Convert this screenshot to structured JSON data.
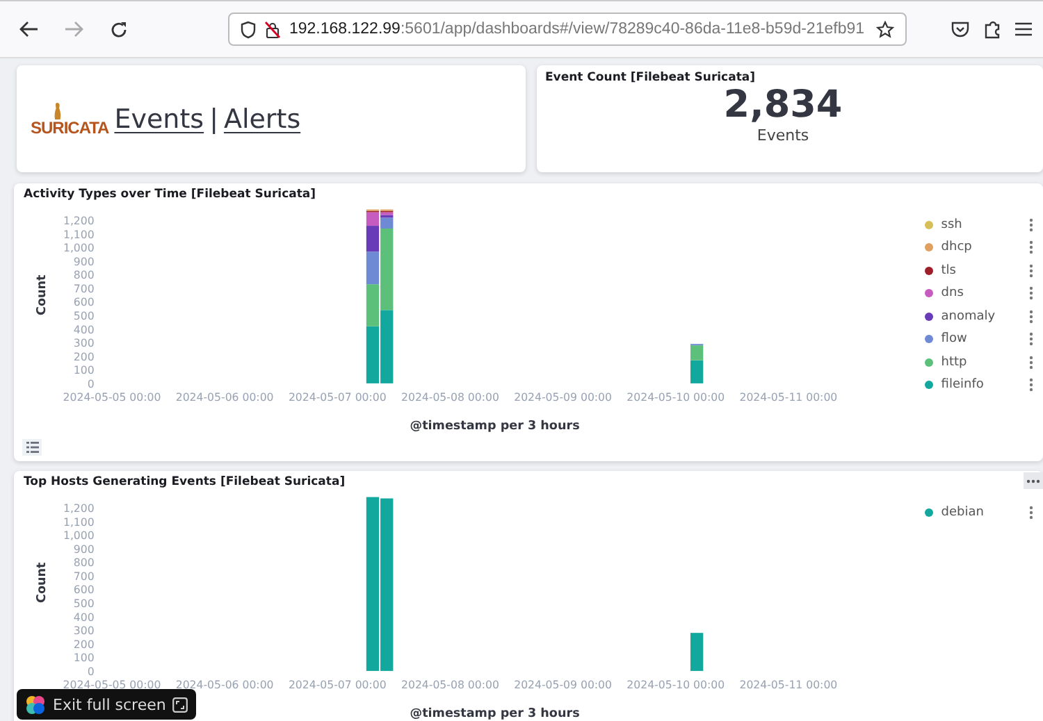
{
  "browser": {
    "url_host": "192.168.122.99",
    "url_rest": ":5601/app/dashboards#/view/78289c40-86da-11e8-b59d-21efb91",
    "forward_disabled": true
  },
  "logo_panel": {
    "logo": "SURICATA",
    "links": [
      "Events",
      "Alerts"
    ],
    "separator": "|"
  },
  "metric_panel": {
    "title": "Event Count [Filebeat Suricata]",
    "value": "2,834",
    "label": "Events"
  },
  "charts": [
    {
      "title": "Activity Types over Time [Filebeat Suricata]",
      "legend_toggle": true,
      "panel_menu": false,
      "chart_data": {
        "type": "bar",
        "stacked": true,
        "xlabel": "@timestamp per 3 hours",
        "ylabel": "Count",
        "ylim": [
          0,
          1300
        ],
        "yticks": [
          0,
          100,
          200,
          300,
          400,
          500,
          600,
          700,
          800,
          900,
          {
            "value": 1000,
            "label": "1,000"
          },
          {
            "value": 1100,
            "label": "1,100"
          },
          {
            "value": 1200,
            "label": "1,200"
          }
        ],
        "categories": [
          "2024-05-05 00:00",
          null,
          null,
          null,
          null,
          null,
          null,
          null,
          "2024-05-06 00:00",
          null,
          null,
          null,
          null,
          null,
          null,
          null,
          "2024-05-07 00:00",
          null,
          null,
          null,
          null,
          null,
          null,
          null,
          "2024-05-08 00:00",
          null,
          null,
          null,
          null,
          null,
          null,
          null,
          "2024-05-09 00:00",
          null,
          null,
          null,
          null,
          null,
          null,
          null,
          "2024-05-10 00:00",
          null,
          null,
          null,
          null,
          null,
          null,
          null,
          "2024-05-11 00:00",
          null,
          null,
          null,
          null,
          null,
          null
        ],
        "series": [
          {
            "name": "ssh",
            "color": "#d6bf57",
            "values": [
              null,
              null,
              null,
              null,
              null,
              null,
              null,
              null,
              null,
              null,
              null,
              null,
              null,
              null,
              null,
              null,
              null,
              null,
              0,
              0,
              null,
              null,
              null,
              null,
              null,
              null,
              null,
              null,
              null,
              null,
              null,
              null,
              null,
              null,
              null,
              null,
              null,
              null,
              null,
              null,
              null,
              0,
              null,
              null,
              null,
              null,
              null,
              null,
              null,
              null,
              null,
              null,
              null,
              null,
              null
            ]
          },
          {
            "name": "dhcp",
            "color": "#e0a060",
            "values": [
              null,
              null,
              null,
              null,
              null,
              null,
              null,
              null,
              null,
              null,
              null,
              null,
              null,
              null,
              null,
              null,
              null,
              null,
              10,
              10,
              null,
              null,
              null,
              null,
              null,
              null,
              null,
              null,
              null,
              null,
              null,
              null,
              null,
              null,
              null,
              null,
              null,
              null,
              null,
              null,
              null,
              0,
              null,
              null,
              null,
              null,
              null,
              null,
              null,
              null,
              null,
              null,
              null,
              null,
              null
            ]
          },
          {
            "name": "tls",
            "color": "#9e1f2a",
            "values": [
              null,
              null,
              null,
              null,
              null,
              null,
              null,
              null,
              null,
              null,
              null,
              null,
              null,
              null,
              null,
              null,
              null,
              null,
              10,
              10,
              null,
              null,
              null,
              null,
              null,
              null,
              null,
              null,
              null,
              null,
              null,
              null,
              null,
              null,
              null,
              null,
              null,
              null,
              null,
              null,
              null,
              0,
              null,
              null,
              null,
              null,
              null,
              null,
              null,
              null,
              null,
              null,
              null,
              null,
              null
            ]
          },
          {
            "name": "dns",
            "color": "#c65bc0",
            "values": [
              null,
              null,
              null,
              null,
              null,
              null,
              null,
              null,
              null,
              null,
              null,
              null,
              null,
              null,
              null,
              null,
              null,
              null,
              100,
              20,
              null,
              null,
              null,
              null,
              null,
              null,
              null,
              null,
              null,
              null,
              null,
              null,
              null,
              null,
              null,
              null,
              null,
              null,
              null,
              null,
              null,
              0,
              null,
              null,
              null,
              null,
              null,
              null,
              null,
              null,
              null,
              null,
              null,
              null,
              null
            ]
          },
          {
            "name": "anomaly",
            "color": "#6a3bb8",
            "values": [
              null,
              null,
              null,
              null,
              null,
              null,
              null,
              null,
              null,
              null,
              null,
              null,
              null,
              null,
              null,
              null,
              null,
              null,
              190,
              20,
              null,
              null,
              null,
              null,
              null,
              null,
              null,
              null,
              null,
              null,
              null,
              null,
              null,
              null,
              null,
              null,
              null,
              null,
              null,
              null,
              null,
              0,
              null,
              null,
              null,
              null,
              null,
              null,
              null,
              null,
              null,
              null,
              null,
              null,
              null
            ]
          },
          {
            "name": "flow",
            "color": "#6f8ad4",
            "values": [
              null,
              null,
              null,
              null,
              null,
              null,
              null,
              null,
              null,
              null,
              null,
              null,
              null,
              null,
              null,
              null,
              null,
              null,
              240,
              80,
              null,
              null,
              null,
              null,
              null,
              null,
              null,
              null,
              null,
              null,
              null,
              null,
              null,
              null,
              null,
              null,
              null,
              null,
              null,
              null,
              null,
              10,
              null,
              null,
              null,
              null,
              null,
              null,
              null,
              null,
              null,
              null,
              null,
              null,
              null
            ]
          },
          {
            "name": "http",
            "color": "#5cc07a",
            "values": [
              null,
              null,
              null,
              null,
              null,
              null,
              null,
              null,
              null,
              null,
              null,
              null,
              null,
              null,
              null,
              null,
              null,
              null,
              310,
              600,
              null,
              null,
              null,
              null,
              null,
              null,
              null,
              null,
              null,
              null,
              null,
              null,
              null,
              null,
              null,
              null,
              null,
              null,
              null,
              null,
              null,
              110,
              null,
              null,
              null,
              null,
              null,
              null,
              null,
              null,
              null,
              null,
              null,
              null,
              null
            ]
          },
          {
            "name": "fileinfo",
            "color": "#13a89e",
            "values": [
              null,
              null,
              null,
              null,
              null,
              null,
              null,
              null,
              null,
              null,
              null,
              null,
              null,
              null,
              null,
              null,
              null,
              null,
              420,
              540,
              null,
              null,
              null,
              null,
              null,
              null,
              null,
              null,
              null,
              null,
              null,
              null,
              null,
              null,
              null,
              null,
              null,
              null,
              null,
              null,
              null,
              170,
              null,
              null,
              null,
              null,
              null,
              null,
              null,
              null,
              null,
              null,
              null,
              null,
              null
            ]
          }
        ]
      }
    },
    {
      "title": "Top Hosts Generating Events [Filebeat Suricata]",
      "legend_toggle": false,
      "panel_menu": true,
      "chart_data": {
        "type": "bar",
        "stacked": true,
        "xlabel": "@timestamp per 3 hours",
        "ylabel": "Count",
        "ylim": [
          0,
          1300
        ],
        "yticks": [
          0,
          100,
          200,
          300,
          400,
          500,
          600,
          700,
          800,
          900,
          {
            "value": 1000,
            "label": "1,000"
          },
          {
            "value": 1100,
            "label": "1,100"
          },
          {
            "value": 1200,
            "label": "1,200"
          }
        ],
        "categories": [
          "2024-05-05 00:00",
          null,
          null,
          null,
          null,
          null,
          null,
          null,
          "2024-05-06 00:00",
          null,
          null,
          null,
          null,
          null,
          null,
          null,
          "2024-05-07 00:00",
          null,
          null,
          null,
          null,
          null,
          null,
          null,
          "2024-05-08 00:00",
          null,
          null,
          null,
          null,
          null,
          null,
          null,
          "2024-05-09 00:00",
          null,
          null,
          null,
          null,
          null,
          null,
          null,
          "2024-05-10 00:00",
          null,
          null,
          null,
          null,
          null,
          null,
          null,
          "2024-05-11 00:00",
          null,
          null,
          null,
          null,
          null,
          null
        ],
        "series": [
          {
            "name": "debian",
            "color": "#13a89e",
            "values": [
              null,
              null,
              null,
              null,
              null,
              null,
              null,
              null,
              null,
              null,
              null,
              null,
              null,
              null,
              null,
              null,
              null,
              null,
              1280,
              1270,
              null,
              null,
              null,
              null,
              null,
              null,
              null,
              null,
              null,
              null,
              null,
              null,
              null,
              null,
              null,
              null,
              null,
              null,
              null,
              null,
              null,
              280,
              null,
              null,
              null,
              null,
              null,
              null,
              null,
              null,
              null,
              null,
              null,
              null,
              null
            ]
          }
        ]
      }
    }
  ],
  "toast": {
    "text": "Exit full screen"
  }
}
